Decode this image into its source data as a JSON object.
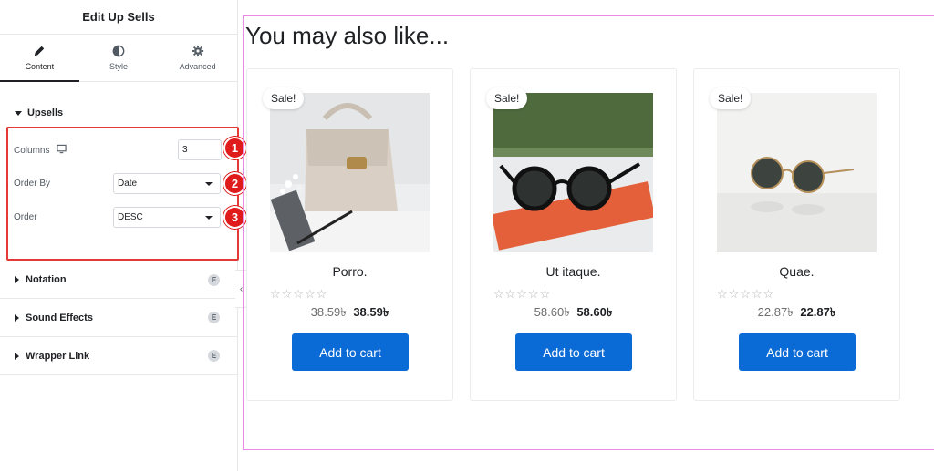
{
  "panel": {
    "title": "Edit Up Sells",
    "tabs": [
      {
        "label": "Content",
        "icon": "pencil-icon"
      },
      {
        "label": "Style",
        "icon": "half-circle-icon"
      },
      {
        "label": "Advanced",
        "icon": "gear-icon"
      }
    ],
    "section": {
      "title": "Upsells",
      "columns_label": "Columns",
      "columns_value": "3",
      "order_by_label": "Order By",
      "order_by_value": "Date",
      "order_label": "Order",
      "order_value": "DESC"
    },
    "badges": [
      "1",
      "2",
      "3"
    ],
    "collapsed_sections": [
      {
        "title": "Notation"
      },
      {
        "title": "Sound Effects"
      },
      {
        "title": "Wrapper Link"
      }
    ]
  },
  "preview": {
    "heading": "You may also like...",
    "products": [
      {
        "sale": "Sale!",
        "name": "Porro.",
        "stars": "☆☆☆☆☆",
        "old_price": "38.59৳",
        "new_price": "38.59৳",
        "button": "Add to cart"
      },
      {
        "sale": "Sale!",
        "name": "Ut itaque.",
        "stars": "☆☆☆☆☆",
        "old_price": "58.60৳",
        "new_price": "58.60৳",
        "button": "Add to cart"
      },
      {
        "sale": "Sale!",
        "name": "Quae.",
        "stars": "☆☆☆☆☆",
        "old_price": "22.87৳",
        "new_price": "22.87৳",
        "button": "Add to cart"
      }
    ]
  },
  "colors": {
    "accent_button": "#0b6bd6",
    "highlight": "#e53935",
    "preview_border": "#e88be3"
  }
}
